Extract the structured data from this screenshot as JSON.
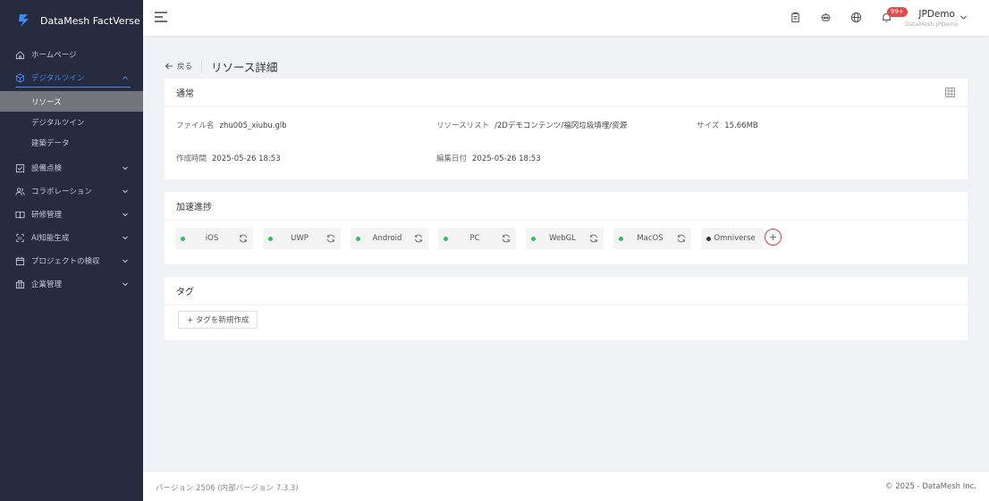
{
  "brand": {
    "name": "DataMesh FactVerse",
    "color": "#3d8bff"
  },
  "sidebar": {
    "items": [
      {
        "label": "ホームページ",
        "icon": "home-icon"
      },
      {
        "label": "デジタルツイン",
        "icon": "cube-icon",
        "active": true,
        "children": [
          {
            "label": "リソース",
            "selected": true
          },
          {
            "label": "デジタルツイン"
          },
          {
            "label": "建築データ"
          }
        ]
      },
      {
        "label": "設備点検",
        "icon": "checkbox-icon"
      },
      {
        "label": "コラボレーション",
        "icon": "users-icon"
      },
      {
        "label": "研修管理",
        "icon": "book-icon"
      },
      {
        "label": "AI知能生成",
        "icon": "ai-icon"
      },
      {
        "label": "プロジェクトの検収",
        "icon": "calendar-icon"
      },
      {
        "label": "企業管理",
        "icon": "building-icon"
      }
    ]
  },
  "header": {
    "badge": "99+",
    "user_name": "JPDemo",
    "user_sub": "DataMesh.JPDemo"
  },
  "page": {
    "back_label": "戻る",
    "title": "リソース詳細"
  },
  "general": {
    "title": "通常",
    "file_name_label": "ファイル名",
    "file_name": "zhu005_xiubu.glb",
    "resource_list_label": "リソースリスト",
    "resource_list": "/2Dデモコンテンツ/福冈垃圾填埋/资源",
    "size_label": "サイズ",
    "size": "15.66MB",
    "created_label": "作成時間",
    "created": "2025-05-26 18:53",
    "edited_label": "編集日付",
    "edited": "2025-05-26 18:53"
  },
  "acceleration": {
    "title": "加速進捗",
    "platforms": [
      "iOS",
      "UWP",
      "Android",
      "PC",
      "WebGL",
      "MacOS",
      "Omniverse"
    ],
    "status_color_done": "#2fbf5f",
    "plus_label": "+"
  },
  "tags": {
    "title": "タグ",
    "new_tag_label": "+ タグを新規作成"
  },
  "footer": {
    "version": "バージョン 2506 (内部バージョン 7.3.3)",
    "copyright": "© 2025 - DataMesh Inc."
  }
}
